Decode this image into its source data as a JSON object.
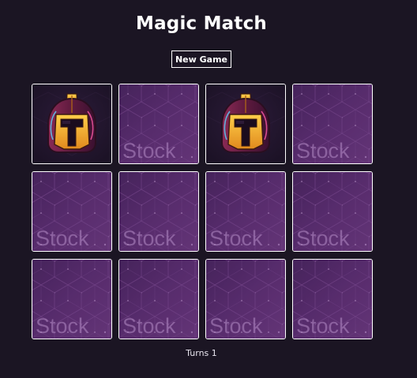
{
  "game": {
    "title": "Magic Match",
    "new_game_label": "New Game",
    "turns_label": "Turns",
    "turns": 1
  },
  "cards": [
    {
      "state": "revealed",
      "image": "helmet-icon"
    },
    {
      "state": "hidden",
      "back_text": "Stock"
    },
    {
      "state": "revealed",
      "image": "helmet-icon"
    },
    {
      "state": "hidden",
      "back_text": "Stock"
    },
    {
      "state": "hidden",
      "back_text": "Stock"
    },
    {
      "state": "hidden",
      "back_text": "Stock"
    },
    {
      "state": "hidden",
      "back_text": "Stock"
    },
    {
      "state": "hidden",
      "back_text": "Stock"
    },
    {
      "state": "hidden",
      "back_text": "Stock"
    },
    {
      "state": "hidden",
      "back_text": "Stock"
    },
    {
      "state": "hidden",
      "back_text": "Stock"
    },
    {
      "state": "hidden",
      "back_text": "Stock"
    }
  ],
  "colors": {
    "background": "#1b1523",
    "card_back": "#5a2e6e",
    "helmet_gold": "#f0a92a"
  }
}
